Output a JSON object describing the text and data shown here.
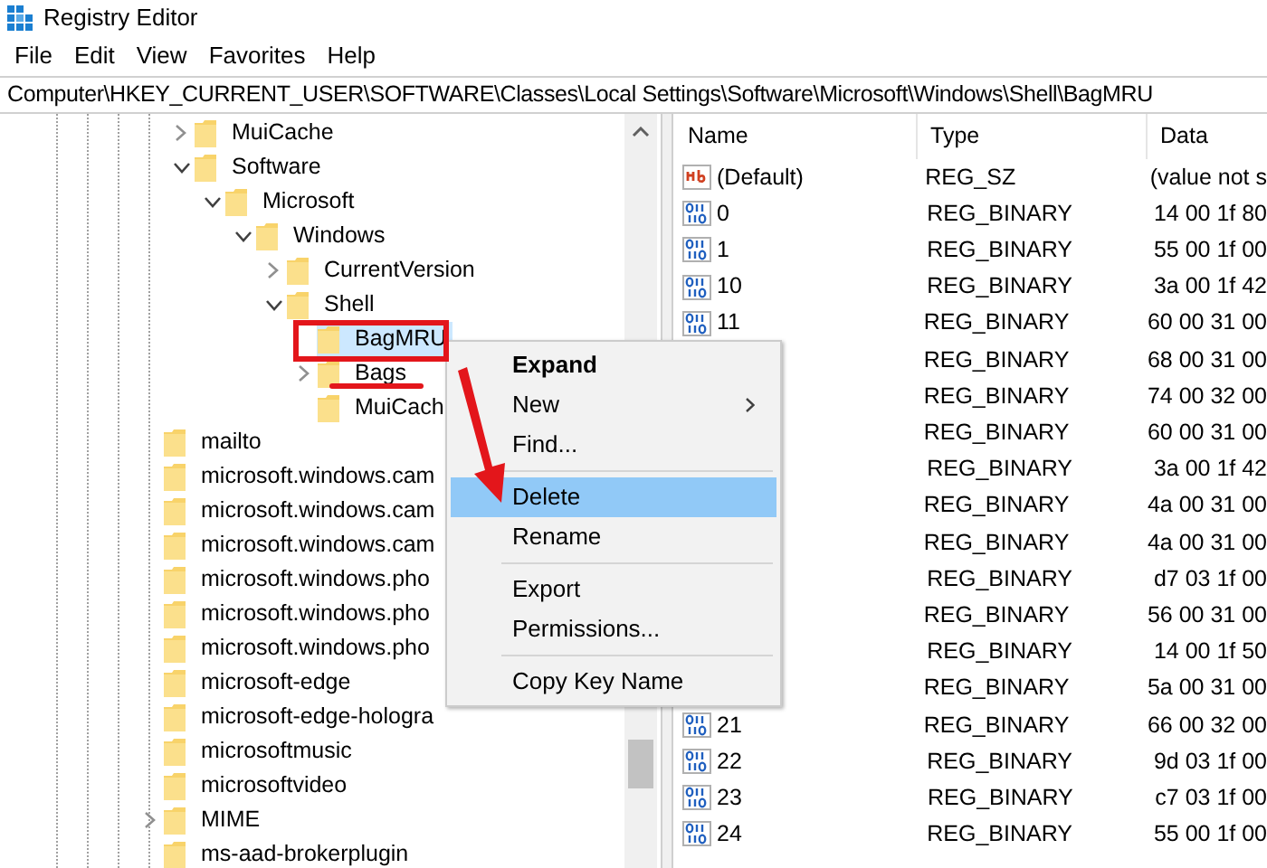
{
  "window": {
    "title": "Registry Editor"
  },
  "menu_bar": [
    "File",
    "Edit",
    "View",
    "Favorites",
    "Help"
  ],
  "address_bar": "Computer\\HKEY_CURRENT_USER\\SOFTWARE\\Classes\\Local Settings\\Software\\Microsoft\\Windows\\Shell\\BagMRU",
  "tree": {
    "continued_children": [
      {
        "label": "MuiCache",
        "expanded": false,
        "selected": false
      },
      {
        "label": "Software",
        "expanded": true,
        "selected": false,
        "children": [
          {
            "label": "Microsoft",
            "expanded": true,
            "selected": false,
            "children": [
              {
                "label": "Windows",
                "expanded": true,
                "selected": false,
                "children": [
                  {
                    "label": "CurrentVersion",
                    "expanded": false,
                    "selected": false
                  },
                  {
                    "label": "Shell",
                    "expanded": true,
                    "selected": false,
                    "children": [
                      {
                        "label": "BagMRU",
                        "selected": true
                      },
                      {
                        "label": "Bags",
                        "expanded": false,
                        "selected": false
                      },
                      {
                        "label": "MuiCach",
                        "selected": false
                      }
                    ]
                  }
                ]
              }
            ]
          }
        ]
      }
    ],
    "items": [
      {
        "label": "mailto",
        "selected": false
      },
      {
        "label": "microsoft.windows.cam",
        "selected": false
      },
      {
        "label": "microsoft.windows.cam",
        "selected": false
      },
      {
        "label": "microsoft.windows.cam",
        "selected": false
      },
      {
        "label": "microsoft.windows.pho",
        "selected": false
      },
      {
        "label": "microsoft.windows.pho",
        "selected": false
      },
      {
        "label": "microsoft.windows.pho",
        "selected": false
      },
      {
        "label": "microsoft-edge",
        "selected": false
      },
      {
        "label": "microsoft-edge-hologra",
        "selected": false
      },
      {
        "label": "microsoftmusic",
        "selected": false
      },
      {
        "label": "microsoftvideo",
        "selected": false
      },
      {
        "label": "MIME",
        "expanded": false,
        "selected": false
      },
      {
        "label": "ms-aad-brokerplugin",
        "selected": false
      }
    ]
  },
  "values": {
    "columns": [
      "Name",
      "Type",
      "Data"
    ],
    "rows": [
      {
        "kind": "string",
        "name": "(Default)",
        "type": "REG_SZ",
        "data": "(value not s"
      },
      {
        "kind": "binary",
        "name": "0",
        "type": "REG_BINARY",
        "data": "14 00 1f 80"
      },
      {
        "kind": "binary",
        "name": "1",
        "type": "REG_BINARY",
        "data": "55 00 1f 00"
      },
      {
        "kind": "binary",
        "name": "10",
        "type": "REG_BINARY",
        "data": "3a 00 1f 42"
      },
      {
        "kind": "binary",
        "name": "11",
        "type": "REG_BINARY",
        "data": "60 00 31 00"
      },
      {
        "type": "REG_BINARY",
        "data": "68 00 31 00"
      },
      {
        "type": "REG_BINARY",
        "data": "74 00 32 00"
      },
      {
        "type": "REG_BINARY",
        "data": "60 00 31 00"
      },
      {
        "type": "REG_BINARY",
        "data": "3a 00 1f 42"
      },
      {
        "type": "REG_BINARY",
        "data": "4a 00 31 00"
      },
      {
        "type": "REG_BINARY",
        "data": "4a 00 31 00"
      },
      {
        "type": "REG_BINARY",
        "data": "d7 03 1f 00"
      },
      {
        "type": "REG_BINARY",
        "data": "56 00 31 00"
      },
      {
        "type": "REG_BINARY",
        "data": "14 00 1f 50"
      },
      {
        "type": "REG_BINARY",
        "data": "5a 00 31 00"
      },
      {
        "kind": "binary",
        "name": "21",
        "type": "REG_BINARY",
        "data": "66 00 32 00"
      },
      {
        "kind": "binary",
        "name": "22",
        "type": "REG_BINARY",
        "data": "9d 03 1f 00"
      },
      {
        "kind": "binary",
        "name": "23",
        "type": "REG_BINARY",
        "data": "c7 03 1f 00"
      },
      {
        "kind": "binary",
        "name": "24",
        "type": "REG_BINARY",
        "data": "55 00 1f 00"
      }
    ]
  },
  "context_menu": [
    {
      "kind": "item",
      "label": "Expand",
      "default": true,
      "submenu": false,
      "selected": false
    },
    {
      "kind": "item",
      "label": "New",
      "default": false,
      "submenu": true,
      "selected": false
    },
    {
      "kind": "item",
      "label": "Find...",
      "default": false,
      "submenu": false,
      "selected": false
    },
    {
      "kind": "separator"
    },
    {
      "kind": "item",
      "label": "Delete",
      "default": false,
      "submenu": false,
      "selected": true
    },
    {
      "kind": "item",
      "label": "Rename",
      "default": false,
      "submenu": false,
      "selected": false
    },
    {
      "kind": "separator"
    },
    {
      "kind": "item",
      "label": "Export",
      "default": false,
      "submenu": false,
      "selected": false
    },
    {
      "kind": "item",
      "label": "Permissions...",
      "default": false,
      "submenu": false,
      "selected": false
    },
    {
      "kind": "separator"
    },
    {
      "kind": "item",
      "label": "Copy Key Name",
      "default": false,
      "submenu": false,
      "selected": false
    }
  ],
  "annotations": [
    {
      "kind": "box"
    },
    {
      "kind": "underline"
    },
    {
      "kind": "arrow"
    }
  ]
}
